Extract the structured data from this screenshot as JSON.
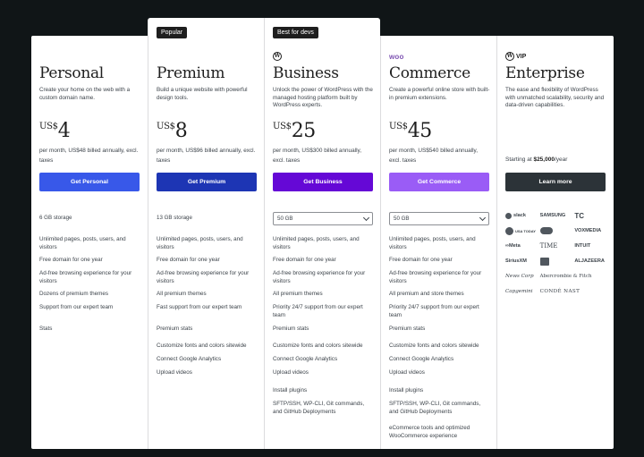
{
  "plans": [
    {
      "name": "Personal",
      "tagline": "Create your home on the web with a custom domain name.",
      "currency": "US$",
      "price": "4",
      "billing": "per month, US$48 billed annually, excl. taxes",
      "cta": "Get Personal",
      "cta_color": "#3858e9",
      "storage": "6 GB storage",
      "features": [
        "Unlimited pages, posts, users, and visitors",
        "Free domain for one year",
        "Ad-free browsing experience for your visitors",
        "Dozens of premium themes",
        "Support from our expert team",
        "Stats"
      ]
    },
    {
      "name": "Premium",
      "badge": "Popular",
      "tagline": "Build a unique website with powerful design tools.",
      "currency": "US$",
      "price": "8",
      "billing": "per month, US$96 billed annually, excl. taxes",
      "cta": "Get Premium",
      "cta_color": "#1d35b4",
      "storage": "13 GB storage",
      "features": [
        "Unlimited pages, posts, users, and visitors",
        "Free domain for one year",
        "Ad-free browsing experience for your visitors",
        "All premium themes",
        "Fast support from our expert team",
        "Premium stats",
        "Customize fonts and colors sitewide",
        "Connect Google Analytics",
        "Upload videos"
      ]
    },
    {
      "name": "Business",
      "badge": "Best for devs",
      "logo": "wordpress-logo-icon",
      "tagline": "Unlock the power of WordPress with the managed hosting platform built by WordPress experts.",
      "currency": "US$",
      "price": "25",
      "billing": "per month, US$300 billed annually, excl. taxes",
      "cta": "Get Business",
      "cta_color": "#6508d6",
      "storage": "50 GB",
      "features": [
        "Unlimited pages, posts, users, and visitors",
        "Free domain for one year",
        "Ad-free browsing experience for your visitors",
        "All premium themes",
        "Priority 24/7 support from our expert team",
        "Premium stats",
        "Customize fonts and colors sitewide",
        "Connect Google Analytics",
        "Upload videos",
        "Install plugins",
        "SFTP/SSH, WP-CLI, Git commands, and GitHub Deployments"
      ]
    },
    {
      "name": "Commerce",
      "logo_text": "woo",
      "tagline": "Create a powerful online store with built-in premium extensions.",
      "currency": "US$",
      "price": "45",
      "billing": "per month, US$540 billed annually, excl. taxes",
      "cta": "Get Commerce",
      "cta_color": "#9a5cf6",
      "storage": "50 GB",
      "features": [
        "Unlimited pages, posts, users, and visitors",
        "Free domain for one year",
        "Ad-free browsing experience for your visitors",
        "All premium and store themes",
        "Priority 24/7 support from our expert team",
        "Premium stats",
        "Customize fonts and colors sitewide",
        "Connect Google Analytics",
        "Upload videos",
        "Install plugins",
        "SFTP/SSH, WP-CLI, Git commands, and GitHub Deployments",
        "eCommerce tools and optimized WooCommerce experience"
      ]
    },
    {
      "name": "Enterprise",
      "logo_text": "VIP",
      "tagline": "The ease and flexibility of WordPress with unmatched scalability, security and data-driven capabilities.",
      "starting_label": "Starting at",
      "starting_price": "$25,000",
      "starting_suffix": "/year",
      "cta": "Learn more",
      "cta_color": "#2c3338",
      "client_logos": [
        "slack",
        "SAMSUNG",
        "TC",
        "USA TODAY",
        "salesforce",
        "VOXMEDIA",
        "Meta",
        "TIME",
        "INTUIT",
        "SiriusXM",
        "CBS",
        "ALJAZEERA",
        "News Corp",
        "Abercrombie & Fitch",
        "",
        "Capgemini",
        "CONDÉ NAST",
        ""
      ]
    }
  ]
}
